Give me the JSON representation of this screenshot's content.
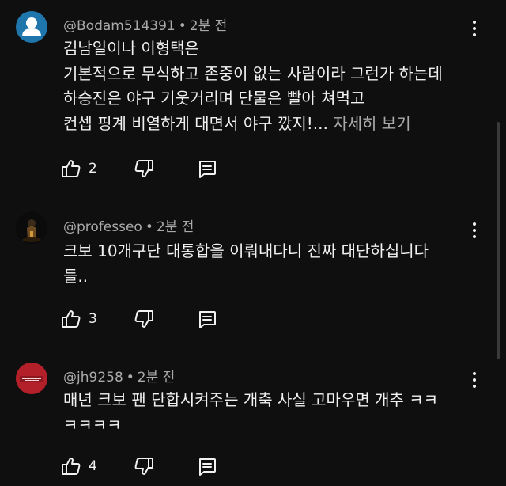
{
  "comments": [
    {
      "author": "@Bodam514391",
      "time": "2분 전",
      "lines": [
        "김남일이나 이형택은",
        "기본적으로 무식하고 존중이 없는 사람이라 그런가 하는데",
        "하승진은 야구 기웃거리며 단물은 빨아 쳐먹고",
        "컨셉 핑계 비열하게 대면서 야구 깠지!..."
      ],
      "more_label": "자세히 보기",
      "likes": "2",
      "avatar_icon": "default-person-icon"
    },
    {
      "author": "@professeo",
      "time": "2분 전",
      "lines": [
        "크보 10개구단 대통합을 이뤄내다니 진짜 대단하십니다",
        "들.."
      ],
      "likes": "3",
      "avatar_icon": "photo-avatar"
    },
    {
      "author": "@jh9258",
      "time": "2분 전",
      "lines": [
        "매년 크보 팬 단합시켜주는 개축 사실 고마우면 개추 ㅋㅋ",
        "ㅋㅋㅋㅋ"
      ],
      "likes": "4",
      "avatar_icon": "red-badge-avatar"
    }
  ],
  "icons": {
    "like": "thumb-up-icon",
    "dislike": "thumb-down-icon",
    "reply": "reply-icon",
    "menu": "more-vert-icon"
  },
  "colors": {
    "background": "#0f0f0f",
    "text": "#f1f1f1",
    "secondary": "#aaaaaa",
    "avatar_default": "#1e76ac"
  }
}
